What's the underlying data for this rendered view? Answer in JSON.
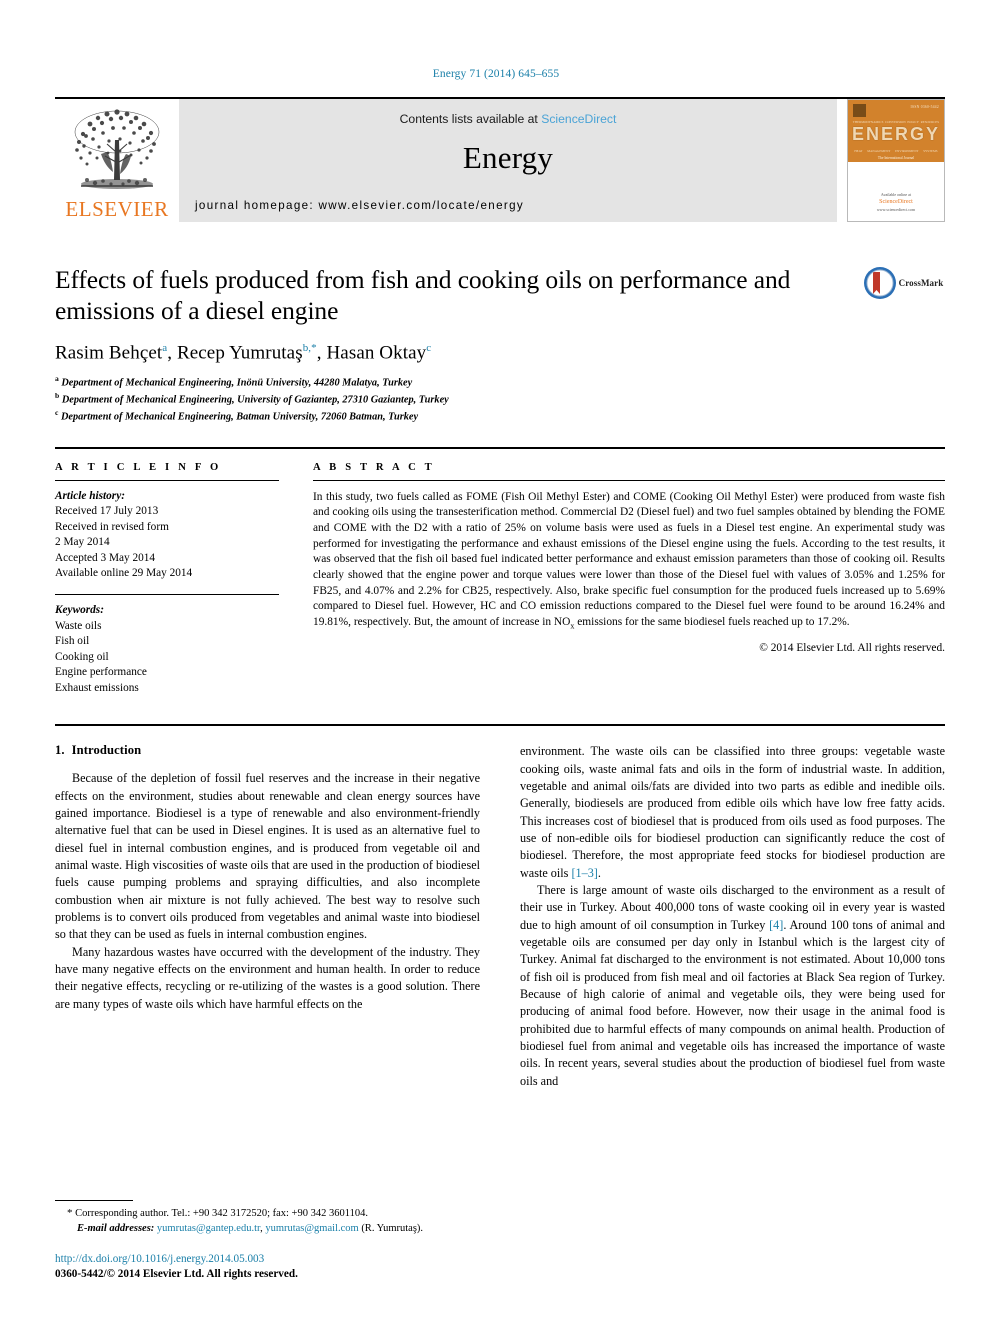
{
  "running_head": "Energy 71 (2014) 645–655",
  "masthead": {
    "publisher": "ELSEVIER",
    "contents_prefix": "Contents lists available at ",
    "sciencedirect": "ScienceDirect",
    "journal_title": "Energy",
    "homepage": "journal homepage: www.elsevier.com/locate/energy",
    "cover": {
      "issue_label": "ISSN 0360-5442",
      "title": "ENERGY",
      "top_words": [
        "THERMODYNAMICS",
        "CONVERSION",
        "POLICY",
        "RESOURCES"
      ],
      "bottom_words": [
        "HEAT",
        "MANAGEMENT",
        "ENVIRONMENT",
        "SYSTEMS"
      ],
      "subtitle": "The International Journal",
      "foot_prefix": "Available online at",
      "foot_brand": "ScienceDirect",
      "foot_url": "www.sciencedirect.com"
    }
  },
  "article": {
    "title": "Effects of fuels produced from fish and cooking oils on performance and emissions of a diesel engine",
    "authors_html": "Rasim Behçet, Recep Yumrutaş, Hasan Oktay",
    "author_list": [
      {
        "name": "Rasim Behçet",
        "marks": "a"
      },
      {
        "name": "Recep Yumrutaş",
        "marks": "b,*"
      },
      {
        "name": "Hasan Oktay",
        "marks": "c"
      }
    ],
    "affiliations": [
      {
        "mark": "a",
        "text": "Department of Mechanical Engineering, Inönü University, 44280 Malatya, Turkey"
      },
      {
        "mark": "b",
        "text": "Department of Mechanical Engineering, University of Gaziantep, 27310 Gaziantep, Turkey"
      },
      {
        "mark": "c",
        "text": "Department of Mechanical Engineering, Batman University, 72060 Batman, Turkey"
      }
    ],
    "crossmark_label": "CrossMark"
  },
  "article_info": {
    "heading": "A R T I C L E   I N F O",
    "history_label": "Article history:",
    "history": [
      "Received 17 July 2013",
      "Received in revised form",
      "2 May 2014",
      "Accepted 3 May 2014",
      "Available online 29 May 2014"
    ],
    "keywords_label": "Keywords:",
    "keywords": [
      "Waste oils",
      "Fish oil",
      "Cooking oil",
      "Engine performance",
      "Exhaust emissions"
    ]
  },
  "abstract": {
    "heading": "A B S T R A C T",
    "text_part1": "In this study, two fuels called as FOME (Fish Oil Methyl Ester) and COME (Cooking Oil Methyl Ester) were produced from waste fish and cooking oils using the transesterification method. Commercial D2 (Diesel fuel) and two fuel samples obtained by blending the FOME and COME with the D2 with a ratio of 25% on volume basis were used as fuels in a Diesel test engine. An experimental study was performed for investigating the performance and exhaust emissions of the Diesel engine using the fuels. According to the test results, it was observed that the fish oil based fuel indicated better performance and exhaust emission parameters than those of cooking oil. Results clearly showed that the engine power and torque values were lower than those of the Diesel fuel with values of 3.05% and 1.25% for FB25, and 4.07% and 2.2% for CB25, respectively. Also, brake specific fuel consumption for the produced fuels increased up to 5.69% compared to Diesel fuel. However, HC and CO emission reductions compared to the Diesel fuel were found to be around 16.24% and 19.81%, respectively. But, the amount of increase in NO",
    "sub": "x",
    "text_part2": " emissions for the same biodiesel fuels reached up to 17.2%.",
    "copyright": "© 2014 Elsevier Ltd. All rights reserved."
  },
  "introduction": {
    "number": "1.",
    "title": "Introduction",
    "left_paragraphs": [
      "Because of the depletion of fossil fuel reserves and the increase in their negative effects on the environment, studies about renewable and clean energy sources have gained importance. Biodiesel is a type of renewable and also environment-friendly alternative fuel that can be used in Diesel engines. It is used as an alternative fuel to diesel fuel in internal combustion engines, and is produced from vegetable oil and animal waste. High viscosities of waste oils that are used in the production of biodiesel fuels cause pumping problems and spraying difficulties, and also incomplete combustion when air mixture is not fully achieved. The best way to resolve such problems is to convert oils produced from vegetables and animal waste into biodiesel so that they can be used as fuels in internal combustion engines.",
      "Many hazardous wastes have occurred with the development of the industry. They have many negative effects on the environment and human health. In order to reduce their negative effects, recycling or re-utilizing of the wastes is a good solution. There are many types of waste oils which have harmful effects on the"
    ],
    "right_par1_a": "environment. The waste oils can be classified into three groups: vegetable waste cooking oils, waste animal fats and oils in the form of industrial waste. In addition, vegetable and animal oils/fats are divided into two parts as edible and inedible oils. Generally, biodiesels are produced from edible oils which have low free fatty acids. This increases cost of biodiesel that is produced from oils used as food purposes. The use of non-edible oils for biodiesel production can significantly reduce the cost of biodiesel. Therefore, the most appropriate feed stocks for biodiesel production are waste oils ",
    "right_par1_ref": "[1–3]",
    "right_par1_b": ".",
    "right_par2_a": "There is large amount of waste oils discharged to the environment as a result of their use in Turkey. About 400,000 tons of waste cooking oil in every year is wasted due to high amount of oil consumption in Turkey ",
    "right_par2_ref": "[4]",
    "right_par2_b": ". Around 100 tons of animal and vegetable oils are consumed per day only in Istanbul which is the largest city of Turkey. Animal fat discharged to the environment is not estimated. About 10,000 tons of fish oil is produced from fish meal and oil factories at Black Sea region of Turkey. Because of high calorie of animal and vegetable oils, they were being used for producing of animal food before. However, now their usage in the animal food is prohibited due to harmful effects of many compounds on animal health. Production of biodiesel fuel from animal and vegetable oils has increased the importance of waste oils. In recent years, several studies about the production of biodiesel fuel from waste oils and"
  },
  "footnote": {
    "asterisk": "*",
    "corresponding": "Corresponding author. Tel.: +90 342 3172520; fax: +90 342 3601104.",
    "email_label": "E-mail addresses:",
    "email1": "yumrutas@gantep.edu.tr",
    "email_sep": ", ",
    "email2": "yumrutas@gmail.com",
    "email_suffix": " (R. Yumrutaş).",
    "doi": "http://dx.doi.org/10.1016/j.energy.2014.05.003",
    "issn": "0360-5442/© 2014 Elsevier Ltd. All rights reserved."
  },
  "colors": {
    "link": "#1a7fa8",
    "elsevier_orange": "#E87722",
    "band_gray": "#e4e4e4"
  }
}
